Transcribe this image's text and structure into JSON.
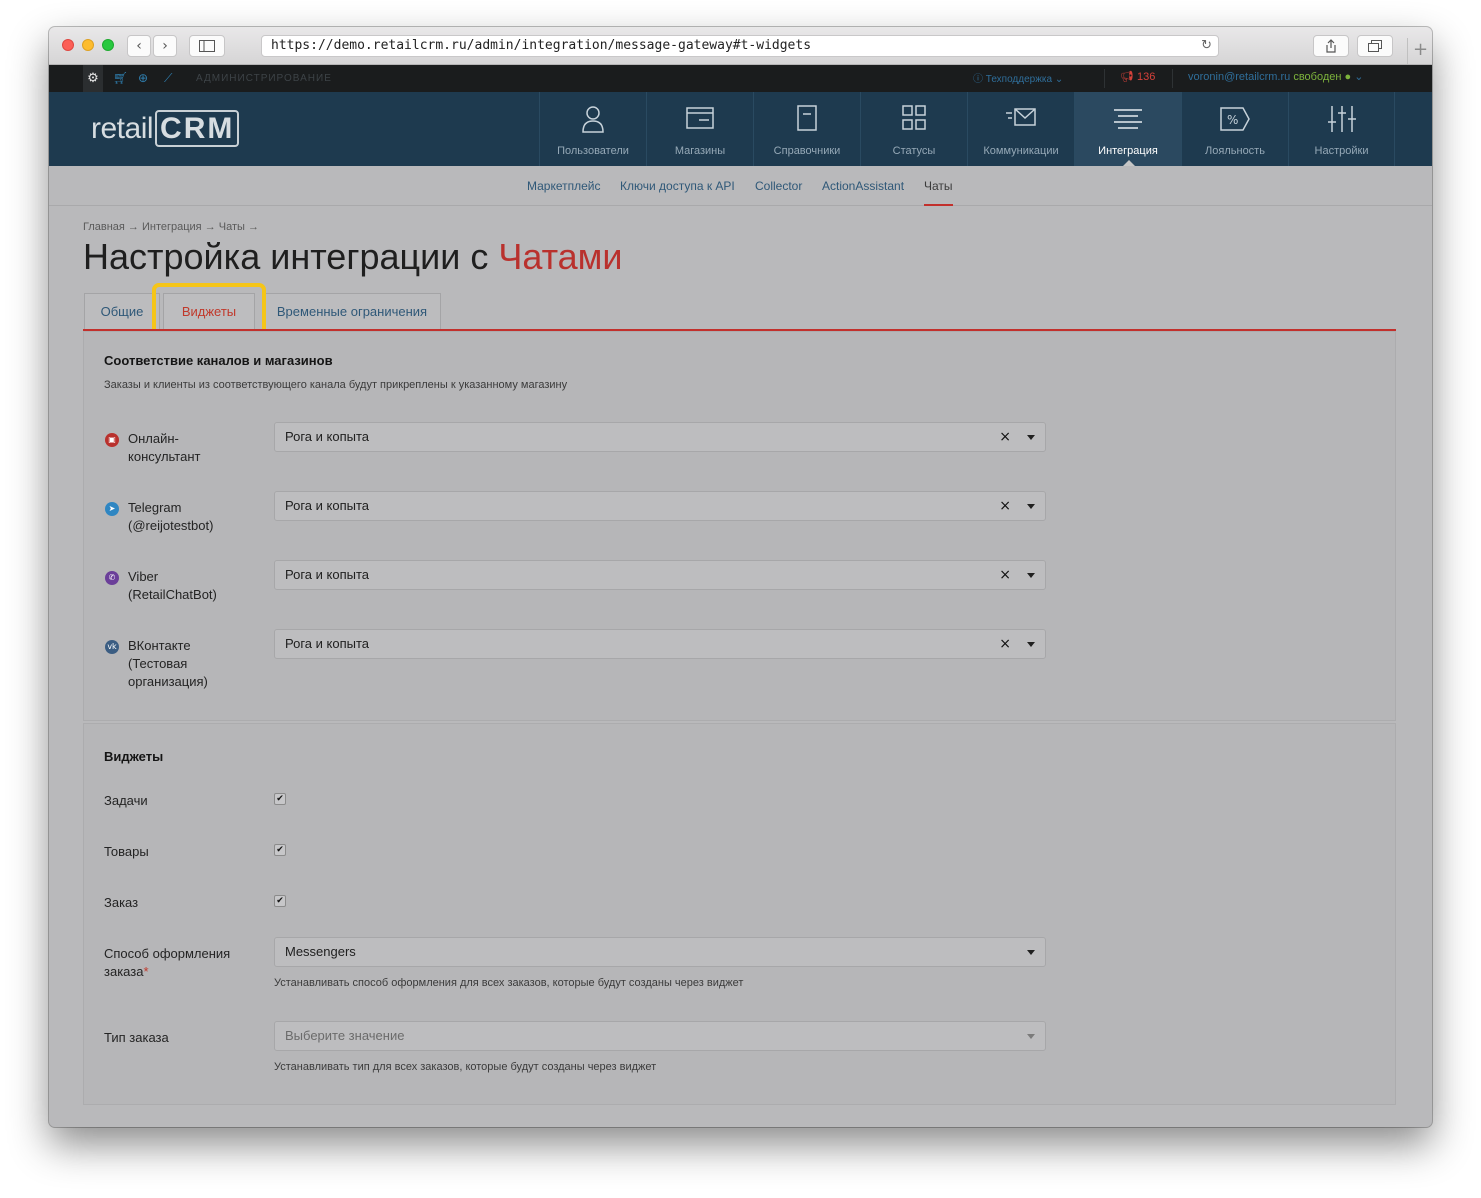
{
  "browser": {
    "url": "https://demo.retailcrm.ru/admin/integration/message-gateway#t-widgets",
    "back": "‹",
    "forward": "›",
    "plus": "+"
  },
  "adminbar": {
    "label": "АДМИНИСТРИРОВАНИЕ",
    "support": "Техподдержка",
    "notifications": "136",
    "user": "voronin@retailcrm.ru",
    "status": "свободен"
  },
  "logo": {
    "retail": "retail",
    "crm": "CRM"
  },
  "nav": [
    {
      "label": "Пользователи",
      "icon": "user-icon"
    },
    {
      "label": "Магазины",
      "icon": "store-icon"
    },
    {
      "label": "Справочники",
      "icon": "reference-icon"
    },
    {
      "label": "Статусы",
      "icon": "statuses-icon"
    },
    {
      "label": "Коммуникации",
      "icon": "communications-icon"
    },
    {
      "label": "Интеграция",
      "icon": "integration-icon",
      "active": true
    },
    {
      "label": "Лояльность",
      "icon": "loyalty-icon"
    },
    {
      "label": "Настройки",
      "icon": "settings-sliders-icon"
    }
  ],
  "subnav": [
    "Маркетплейс",
    "Ключи доступа к API",
    "Collector",
    "ActionAssistant",
    "Чаты"
  ],
  "breadcrumb": "Главная → Интеграция → Чаты →",
  "title": {
    "prefix": "Настройка интеграции с ",
    "accent": "Чатами"
  },
  "tabs": [
    "Общие",
    "Виджеты",
    "Временные ограничения"
  ],
  "channels_section": {
    "title": "Соответствие каналов и магазинов",
    "desc": "Заказы и клиенты из соответствующего канала будут прикреплены к указанному магазину",
    "channels": [
      {
        "label": "Онлайн-консультант",
        "icon": "online-consultant-icon",
        "value": "Рога и копыта",
        "color": "#b9312d"
      },
      {
        "label": "Telegram (@reijotestbot)",
        "icon": "telegram-icon",
        "value": "Рога и копыта",
        "color": "#2f86c2"
      },
      {
        "label": "Viber (RetailChatBot)",
        "icon": "viber-icon",
        "value": "Рога и копыта",
        "color": "#6b3f99"
      },
      {
        "label": "ВКонтакте (Тестовая организация)",
        "icon": "vk-icon",
        "value": "Рога и копыта",
        "color": "#3b5d82"
      }
    ]
  },
  "widgets_section": {
    "title": "Виджеты",
    "items": [
      {
        "label": "Задачи",
        "checked": true
      },
      {
        "label": "Товары",
        "checked": true
      },
      {
        "label": "Заказ",
        "checked": true
      }
    ],
    "order_method": {
      "label": "Способ оформления заказа",
      "value": "Messengers",
      "hint": "Устанавливать способ оформления для всех заказов, которые будут созданы через виджет"
    },
    "order_type": {
      "label": "Тип заказа",
      "placeholder": "Выберите значение",
      "hint": "Устанавливать тип для всех заказов, которые будут созданы через виджет"
    }
  },
  "colors": {
    "accent": "#b9312d",
    "header": "#1e3a4f",
    "highlight": "#f5c518"
  }
}
